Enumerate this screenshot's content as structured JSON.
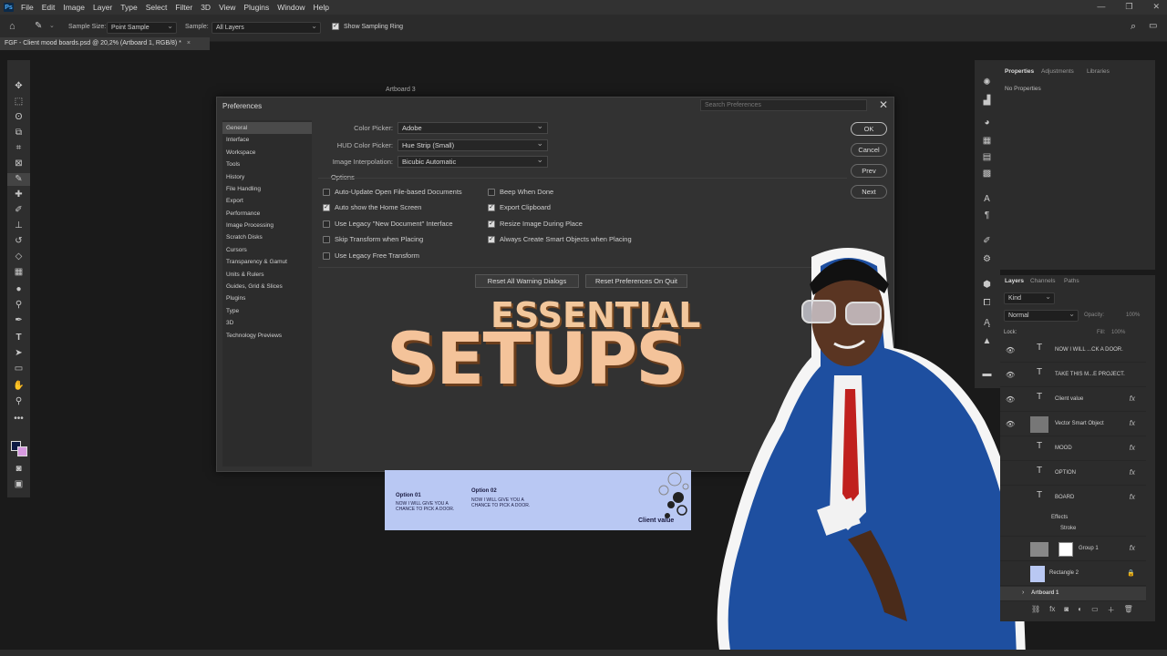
{
  "app": {
    "logo": "Ps"
  },
  "menu": [
    "File",
    "Edit",
    "Image",
    "Layer",
    "Type",
    "Select",
    "Filter",
    "3D",
    "View",
    "Plugins",
    "Window",
    "Help"
  ],
  "options_bar": {
    "sample_size_label": "Sample Size:",
    "sample_size_value": "Point Sample",
    "sample_label": "Sample:",
    "sample_value": "All Layers",
    "show_ring_label": "Show Sampling Ring"
  },
  "document_tab": {
    "title": "FGF - Client mood boards.psd @ 20,2% (Artboard 1, RGB/8) *"
  },
  "canvas": {
    "artboard_label": "Artboard 3"
  },
  "preferences": {
    "title": "Preferences",
    "search_placeholder": "Search Preferences",
    "categories": [
      "General",
      "Interface",
      "Workspace",
      "Tools",
      "History",
      "File Handling",
      "Export",
      "Performance",
      "Image Processing",
      "Scratch Disks",
      "Cursors",
      "Transparency & Gamut",
      "Units & Rulers",
      "Guides, Grid & Slices",
      "Plugins",
      "Type",
      "3D",
      "Technology Previews"
    ],
    "selected_category": "General",
    "color_picker_label": "Color Picker:",
    "color_picker_value": "Adobe",
    "hud_label": "HUD Color Picker:",
    "hud_value": "Hue Strip (Small)",
    "interp_label": "Image Interpolation:",
    "interp_value": "Bicubic Automatic",
    "options_heading": "Options",
    "checkboxes_left": [
      {
        "label": "Auto-Update Open File-based Documents",
        "checked": false
      },
      {
        "label": "Auto show the Home Screen",
        "checked": true
      },
      {
        "label": "Use Legacy \"New Document\" Interface",
        "checked": false
      },
      {
        "label": "Skip Transform when Placing",
        "checked": false
      },
      {
        "label": "Use Legacy Free Transform",
        "checked": false
      }
    ],
    "checkboxes_right": [
      {
        "label": "Beep When Done",
        "checked": false
      },
      {
        "label": "Export Clipboard",
        "checked": true
      },
      {
        "label": "Resize Image During Place",
        "checked": true
      },
      {
        "label": "Always Create Smart Objects when Placing",
        "checked": true
      }
    ],
    "buttons": {
      "ok": "OK",
      "cancel": "Cancel",
      "prev": "Prev",
      "next": "Next"
    },
    "reset_warnings": "Reset All Warning Dialogs",
    "reset_on_quit": "Reset Preferences On Quit"
  },
  "overlay": {
    "line1": "ESSENTIAL",
    "line2": "SETUPS"
  },
  "artboard": {
    "option1_title": "Option 01",
    "option1_text": "NOW I WILL GIVE YOU A CHANCE TO PICK A DOOR.",
    "option2_title": "Option 02",
    "option2_text": "NOW I WILL GIVE YOU A CHANCE TO PICK A DOOR.",
    "client_value": "Client value"
  },
  "properties_panel": {
    "tabs": [
      "Properties",
      "Adjustments",
      "Libraries"
    ],
    "empty_text": "No Properties"
  },
  "layers_panel": {
    "tabs": [
      "Layers",
      "Channels",
      "Paths"
    ],
    "kind_placeholder": "Kind",
    "blend_mode": "Normal",
    "opacity_label": "Opacity:",
    "opacity_value": "100%",
    "lock_label": "Lock:",
    "fill_label": "Fill:",
    "fill_value": "100%",
    "layers": [
      {
        "name": "NOW I WILL ...CK A DOOR.",
        "type": "T",
        "fx": false
      },
      {
        "name": "TAKE THIS M...E PROJECT.",
        "type": "T",
        "fx": false
      },
      {
        "name": "Client value",
        "type": "T",
        "fx": true
      },
      {
        "name": "Vector Smart Object",
        "type": "smart",
        "fx": true
      },
      {
        "name": "MOOD",
        "type": "T",
        "fx": true
      },
      {
        "name": "OPTION",
        "type": "T",
        "fx": true
      },
      {
        "name": "BOARD",
        "type": "T",
        "fx": true
      }
    ],
    "effects_label": "Effects",
    "stroke_label": "Stroke",
    "group_layer": "Group 1",
    "rect_layer": "Rectangle 2",
    "artboard_group": "Artboard 1"
  },
  "colors": {
    "accent": "#f4c39a",
    "dialog_bg": "#323232",
    "artboard_bg": "#b9c8f3",
    "suit": "#1e4fa0",
    "tie": "#c0201e"
  }
}
